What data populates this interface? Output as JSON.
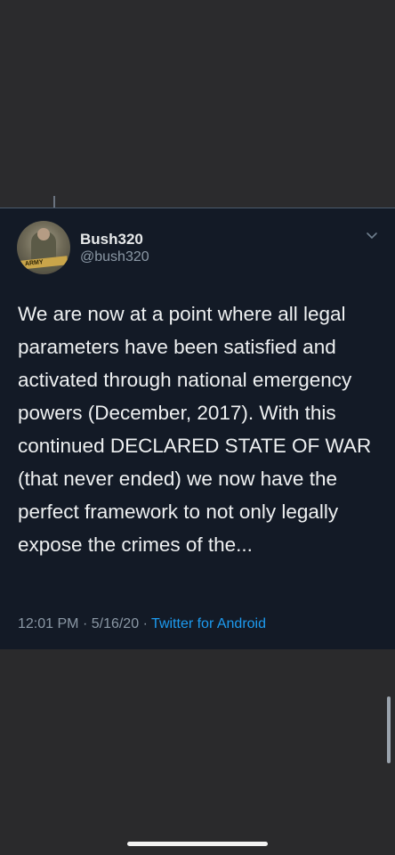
{
  "tweet": {
    "display_name": "Bush320",
    "handle": "@bush320",
    "avatar_text": "ARMY",
    "text": "We are now at a point where all legal parameters have been satisfied and activated through national emergency powers (December, 2017). With this continued DECLARED STATE OF WAR (that never ended) we now have the perfect framework to not only legally expose the crimes of the...",
    "time": "12:01 PM",
    "separator": "·",
    "date": "5/16/20",
    "source": "Twitter for Android"
  },
  "icons": {
    "more": "chevron-down-icon"
  },
  "colors": {
    "tweet_background": "#131a26",
    "page_background": "#2a2a2c",
    "link": "#1d9bf0",
    "secondary_text": "#8b98a5"
  }
}
